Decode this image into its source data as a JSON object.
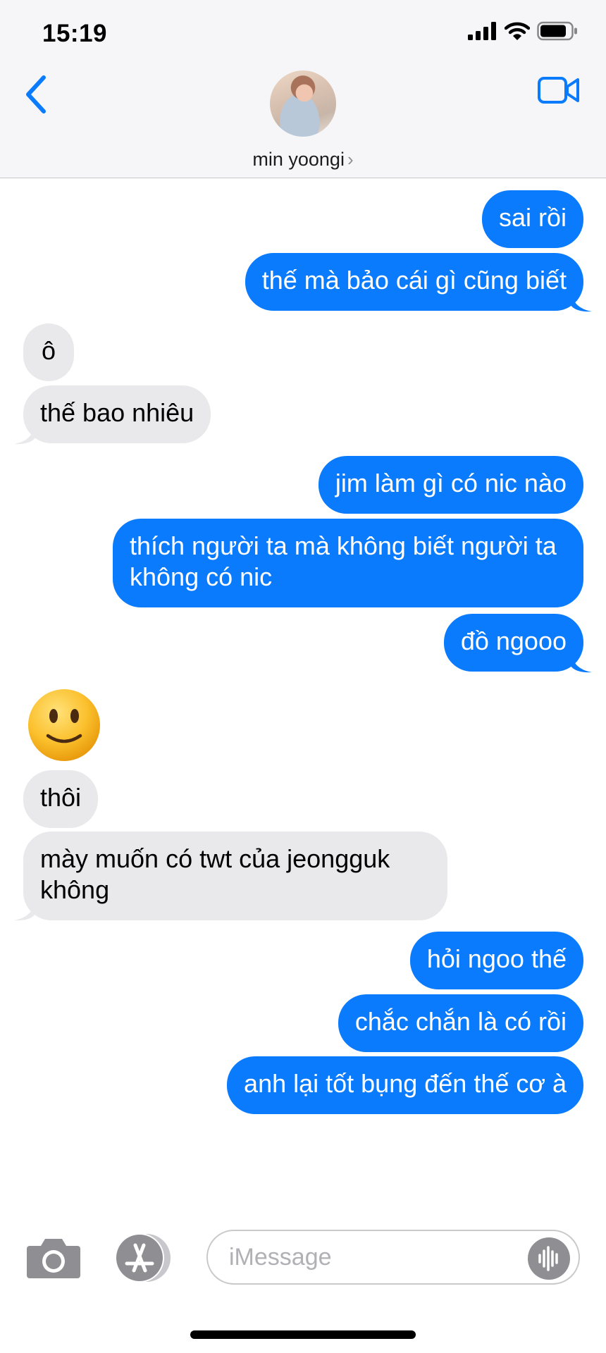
{
  "status_bar": {
    "time": "15:19",
    "icons": [
      "signal-icon",
      "wifi-icon",
      "battery-icon"
    ]
  },
  "header": {
    "contact_name": "min yoongi",
    "chevron": "›",
    "icons": [
      "back-chevron-icon",
      "video-camera-icon"
    ]
  },
  "colors": {
    "outgoing_bubble": "#0b7bfd",
    "incoming_bubble": "#e9e9eb",
    "accent": "#0b7bfd"
  },
  "messages": [
    {
      "direction": "outgoing",
      "text": "sai rồi"
    },
    {
      "direction": "outgoing",
      "text": "thế mà bảo cái gì cũng biết"
    },
    {
      "direction": "incoming",
      "text": "ô"
    },
    {
      "direction": "incoming",
      "text": "thế bao nhiêu"
    },
    {
      "direction": "outgoing",
      "text": "jim làm gì có nic nào"
    },
    {
      "direction": "outgoing",
      "text": "thích người ta mà không biết người ta không có nic"
    },
    {
      "direction": "outgoing",
      "text": "đồ ngooo"
    },
    {
      "direction": "incoming",
      "type": "emoji",
      "emoji": "slightly-smiling-face"
    },
    {
      "direction": "incoming",
      "text": "thôi"
    },
    {
      "direction": "incoming",
      "text": "mày muốn có twt của jeongguk không"
    },
    {
      "direction": "outgoing",
      "text": "hỏi ngoo thế"
    },
    {
      "direction": "outgoing",
      "text": "chắc chắn là có rồi"
    },
    {
      "direction": "outgoing",
      "text": "anh lại tốt bụng đến thế cơ à"
    }
  ],
  "composer": {
    "placeholder": "iMessage",
    "icons": [
      "camera-icon",
      "app-store-icon",
      "audio-waveform-icon"
    ]
  }
}
